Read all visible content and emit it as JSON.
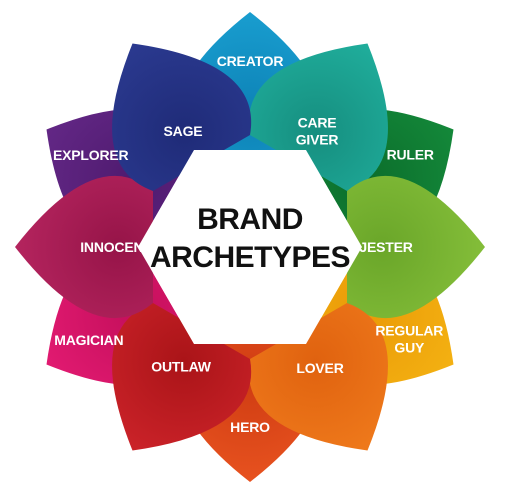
{
  "title_lines": [
    "BRAND",
    "ARCHETYPES"
  ],
  "petals": [
    {
      "id": "creator",
      "lines": [
        "CREATOR"
      ],
      "color": "#1da7d8",
      "dark": "#0d82b6"
    },
    {
      "id": "care-giver",
      "lines": [
        "CARE",
        "GIVER"
      ],
      "color": "#23b9a6",
      "dark": "#168e7f"
    },
    {
      "id": "ruler",
      "lines": [
        "RULER"
      ],
      "color": "#17923f",
      "dark": "#0b6d2b"
    },
    {
      "id": "jester",
      "lines": [
        "JESTER"
      ],
      "color": "#8dc63f",
      "dark": "#6aa629"
    },
    {
      "id": "regular-guy",
      "lines": [
        "REGULAR",
        "GUY"
      ],
      "color": "#f7b916",
      "dark": "#ea9a07"
    },
    {
      "id": "lover",
      "lines": [
        "LOVER"
      ],
      "color": "#f48220",
      "dark": "#e0620f"
    },
    {
      "id": "hero",
      "lines": [
        "HERO"
      ],
      "color": "#f05a24",
      "dark": "#cf3c12"
    },
    {
      "id": "outlaw",
      "lines": [
        "OUTLAW"
      ],
      "color": "#d7282f",
      "dark": "#aa1418"
    },
    {
      "id": "magician",
      "lines": [
        "MAGICIAN"
      ],
      "color": "#ec1e79",
      "dark": "#c40f5b"
    },
    {
      "id": "innocent",
      "lines": [
        "INNOCENT"
      ],
      "color": "#bf2a66",
      "dark": "#961448"
    },
    {
      "id": "explorer",
      "lines": [
        "EXPLORER"
      ],
      "color": "#6a2c8e",
      "dark": "#4e1a6e"
    },
    {
      "id": "sage",
      "lines": [
        "SAGE"
      ],
      "color": "#2f3f98",
      "dark": "#1f2b78"
    }
  ]
}
